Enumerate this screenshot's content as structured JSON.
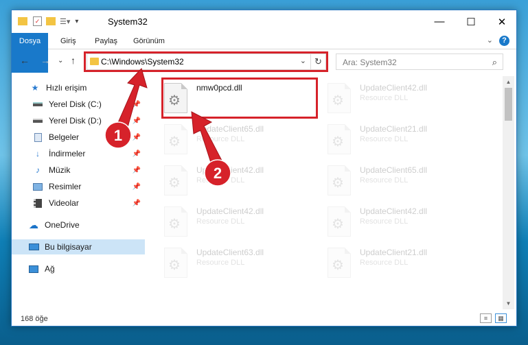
{
  "window": {
    "title": "System32",
    "controls": {
      "minimize": "—",
      "maximize": "☐",
      "close": "✕"
    }
  },
  "ribbon": {
    "tabs": [
      "Dosya",
      "Giriş",
      "Paylaş",
      "Görünüm"
    ],
    "help": "?"
  },
  "navigation": {
    "address": "C:\\Windows\\System32",
    "search_placeholder": "Ara: System32"
  },
  "sidebar": {
    "items": [
      {
        "label": "Hızlı erişim",
        "icon": "star-icon",
        "pinned": false
      },
      {
        "label": "Yerel Disk (C:)",
        "icon": "drive-icon",
        "pinned": true
      },
      {
        "label": "Yerel Disk (D:)",
        "icon": "drive-icon",
        "pinned": true
      },
      {
        "label": "Belgeler",
        "icon": "documents-icon",
        "pinned": true
      },
      {
        "label": "İndirmeler",
        "icon": "download-icon",
        "pinned": true
      },
      {
        "label": "Müzik",
        "icon": "music-icon",
        "pinned": true
      },
      {
        "label": "Resimler",
        "icon": "pictures-icon",
        "pinned": true
      },
      {
        "label": "Videolar",
        "icon": "videos-icon",
        "pinned": true
      },
      {
        "label": "OneDrive",
        "icon": "cloud-icon",
        "pinned": false
      },
      {
        "label": "Bu bilgisayar",
        "icon": "computer-icon",
        "pinned": false,
        "selected": true
      },
      {
        "label": "Ağ",
        "icon": "network-icon",
        "pinned": false
      }
    ]
  },
  "files": [
    {
      "name": "nmw0pcd.dll",
      "desc": ""
    },
    {
      "name": "UpdateClient42.dll",
      "desc": "Resource DLL"
    },
    {
      "name": "UpdateClient65.dll",
      "desc": "Resource DLL"
    },
    {
      "name": "UpdateClient21.dll",
      "desc": "Resource DLL"
    },
    {
      "name": "UpdateClient42.dll",
      "desc": "Resource DLL"
    },
    {
      "name": "UpdateClient65.dll",
      "desc": "Resource DLL"
    },
    {
      "name": "UpdateClient42.dll",
      "desc": "Resource DLL"
    },
    {
      "name": "UpdateClient42.dll",
      "desc": "Resource DLL"
    },
    {
      "name": "UpdateClient63.dll",
      "desc": "Resource DLL"
    },
    {
      "name": "UpdateClient21.dll",
      "desc": "Resource DLL"
    }
  ],
  "status": {
    "item_count": "168 öğe"
  },
  "annotations": {
    "step1": "1",
    "step2": "2",
    "color": "#d6222a"
  }
}
